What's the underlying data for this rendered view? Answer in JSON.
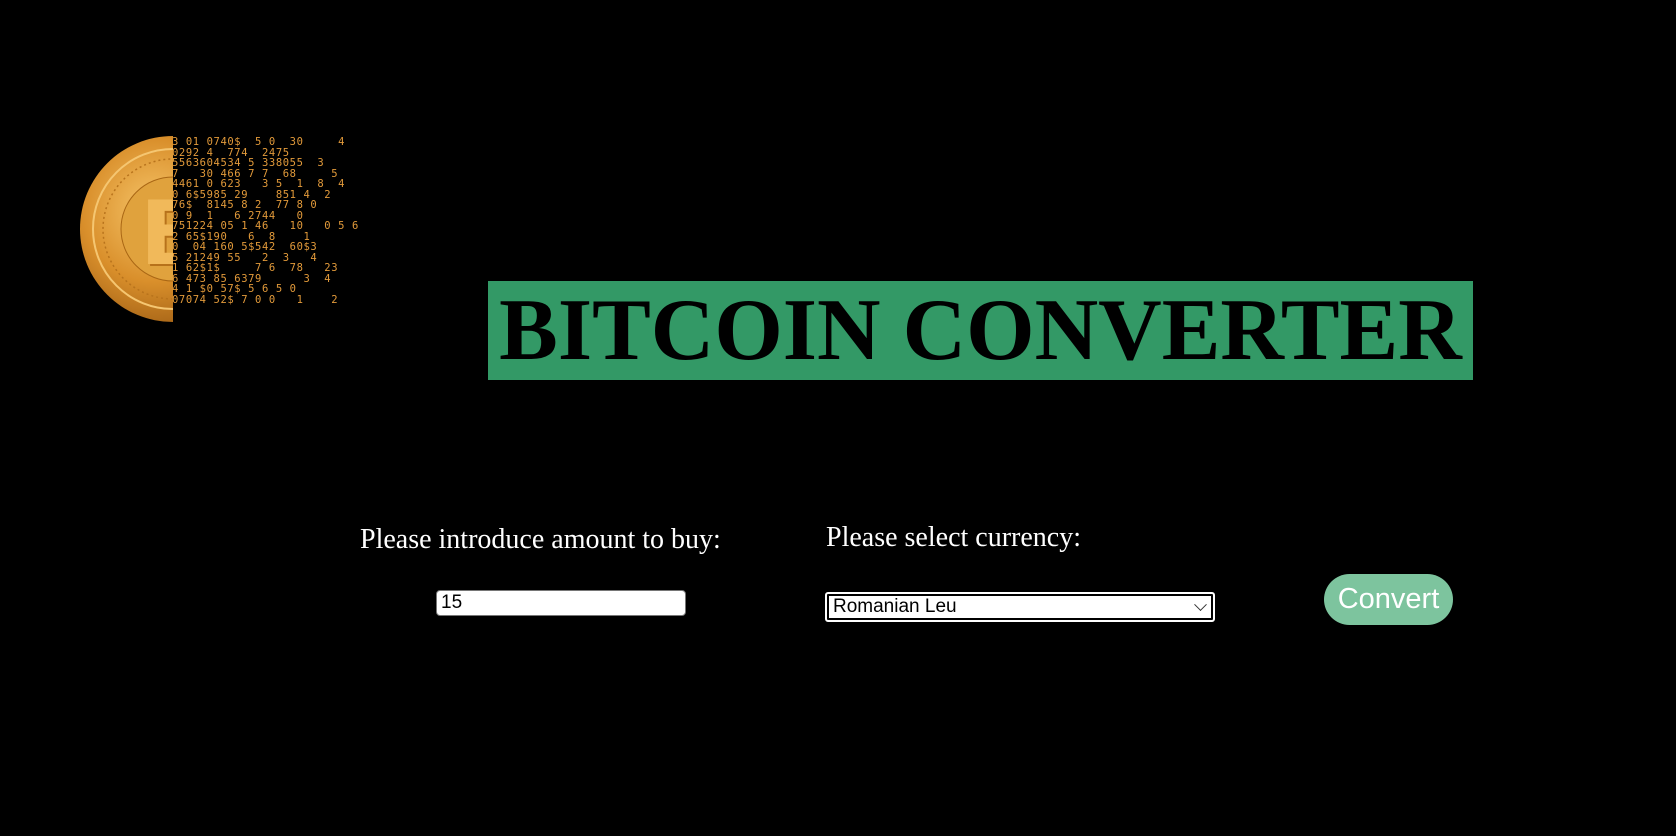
{
  "header": {
    "title": "BITCOIN CONVERTER",
    "logo_icon": "bitcoin-digital-coin-icon"
  },
  "form": {
    "amount_label": "Please introduce amount to buy:",
    "amount_value": "15",
    "currency_label": "Please select currency:",
    "currency_selected": "Romanian Leu",
    "convert_label": "Convert"
  },
  "colors": {
    "background": "#000000",
    "title_bg": "#339966",
    "button_bg": "#7dc49e",
    "coin": "#e29a3a"
  }
}
